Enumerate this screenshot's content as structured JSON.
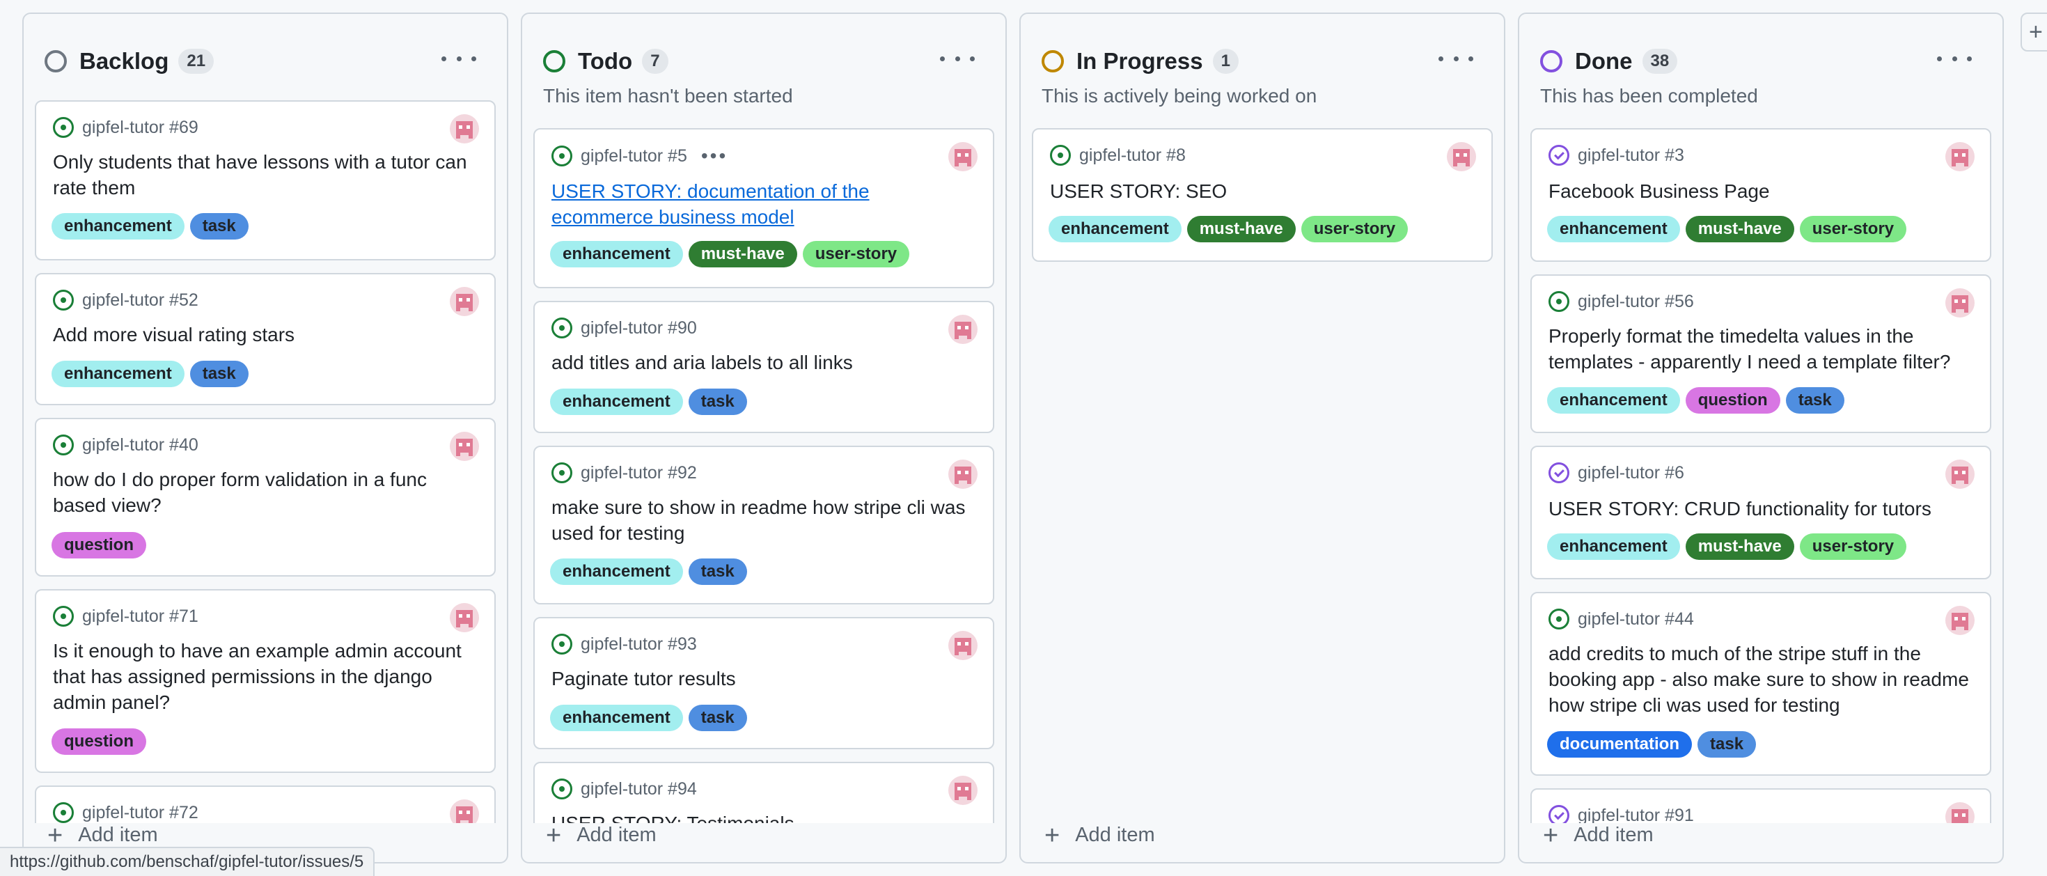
{
  "colors": {
    "backlog_ring": "#6e7781",
    "todo_ring": "#1a7f37",
    "inprogress_ring": "#bf8700",
    "done_ring": "#8250df",
    "label_enhancement": "#a2eeef",
    "label_task": "#4f8ee0",
    "label_must_have": "#2f7d32",
    "label_user_story": "#7ee787",
    "label_question": "#d876e3",
    "label_documentation": "#1f6feb"
  },
  "board": {
    "add_item_label": "Add item",
    "new_column_icon": "plus-icon",
    "columns": [
      {
        "title": "Backlog",
        "count": "21",
        "description": "",
        "cards": [
          {
            "ref": "gipfel-tutor #69",
            "title": "Only students that have lessons with a tutor can rate them",
            "labels": [
              "enhancement",
              "task"
            ]
          },
          {
            "ref": "gipfel-tutor #52",
            "title": "Add more visual rating stars",
            "labels": [
              "enhancement",
              "task"
            ]
          },
          {
            "ref": "gipfel-tutor #40",
            "title": "how do I do proper form validation in a func based view?",
            "labels": [
              "question"
            ]
          },
          {
            "ref": "gipfel-tutor #71",
            "title": "Is it enough to have an example admin account that has assigned permissions in the django admin panel?",
            "labels": [
              "question"
            ]
          },
          {
            "ref": "gipfel-tutor #72",
            "title": "",
            "labels": []
          }
        ]
      },
      {
        "title": "Todo",
        "count": "7",
        "description": "This item hasn't been started",
        "cards": [
          {
            "ref": "gipfel-tutor #5",
            "title": "USER STORY: documentation of the ecommerce business model",
            "labels": [
              "enhancement",
              "must-have",
              "user-story"
            ]
          },
          {
            "ref": "gipfel-tutor #90",
            "title": "add titles and aria labels to all links",
            "labels": [
              "enhancement",
              "task"
            ]
          },
          {
            "ref": "gipfel-tutor #92",
            "title": "make sure to show in readme how stripe cli was used for testing",
            "labels": [
              "enhancement",
              "task"
            ]
          },
          {
            "ref": "gipfel-tutor #93",
            "title": "Paginate tutor results",
            "labels": [
              "enhancement",
              "task"
            ]
          },
          {
            "ref": "gipfel-tutor #94",
            "title": "USER STORY: Testimonials",
            "labels": []
          }
        ]
      },
      {
        "title": "In Progress",
        "count": "1",
        "description": "This is actively being worked on",
        "cards": [
          {
            "ref": "gipfel-tutor #8",
            "title": "USER STORY: SEO",
            "labels": [
              "enhancement",
              "must-have",
              "user-story"
            ]
          }
        ]
      },
      {
        "title": "Done",
        "count": "38",
        "description": "This has been completed",
        "cards": [
          {
            "ref": "gipfel-tutor #3",
            "title": "Facebook Business Page",
            "labels": [
              "enhancement",
              "must-have",
              "user-story"
            ]
          },
          {
            "ref": "gipfel-tutor #56",
            "title": "Properly format the timedelta values in the templates - apparently I need a template filter?",
            "labels": [
              "enhancement",
              "question",
              "task"
            ]
          },
          {
            "ref": "gipfel-tutor #6",
            "title": "USER STORY: CRUD functionality for tutors",
            "labels": [
              "enhancement",
              "must-have",
              "user-story"
            ]
          },
          {
            "ref": "gipfel-tutor #44",
            "title": "add credits to much of the stripe stuff in the booking app - also make sure to show in readme how stripe cli was used for testing",
            "labels": [
              "documentation",
              "task"
            ]
          },
          {
            "ref": "gipfel-tutor #91",
            "title": "",
            "labels": []
          }
        ]
      }
    ]
  },
  "status_bar": {
    "url": "https://github.com/benschaf/gipfel-tutor/issues/5"
  }
}
